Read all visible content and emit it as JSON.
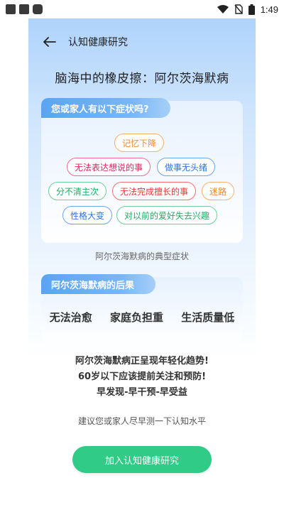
{
  "status_bar": {
    "time": "1:49"
  },
  "header": {
    "title": "认知健康研究"
  },
  "page_title": "脑海中的橡皮擦：阿尔茨海默病",
  "symptoms_card": {
    "tag": "您或家人有以下症状吗?",
    "chips": [
      "记忆下降",
      "无法表达想说的事",
      "做事无头绪",
      "分不清主次",
      "无法完成擅长的事",
      "迷路",
      "性格大变",
      "对以前的爱好失去兴趣"
    ],
    "caption": "阿尔茨海默病的典型症状"
  },
  "consequences_card": {
    "tag": "阿尔茨海默病的后果",
    "items": [
      "无法治愈",
      "家庭负担重",
      "生活质量低"
    ]
  },
  "warning": {
    "line1": "阿尔茨海默病正呈现年轻化趋势!",
    "line2": "60岁以下应该提前关注和预防!",
    "line3": "早发现-早干预-早受益"
  },
  "suggestion": "建议您或家人尽早测一下认知水平",
  "cta_button": "加入认知健康研究",
  "colors": {
    "accent_green": "#2fcb87",
    "tag_blue": "#5aa4f4"
  }
}
